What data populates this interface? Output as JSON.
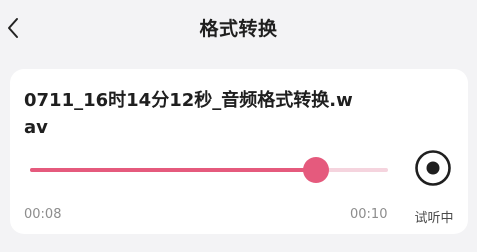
{
  "header": {
    "title": "格式转换",
    "back_icon": "chevron-left-icon"
  },
  "player": {
    "file_name": "0711_16时14分12秒_音频格式转换.wav",
    "current_time": "00:08",
    "total_time": "00:10",
    "progress": 0.8,
    "status_label": "试听中",
    "control_icon": "stop-circle-icon"
  },
  "colors": {
    "accent": "#e55a7d",
    "track_background": "#f5d4de",
    "page_background": "#f3f3f5",
    "card_background": "#ffffff"
  }
}
